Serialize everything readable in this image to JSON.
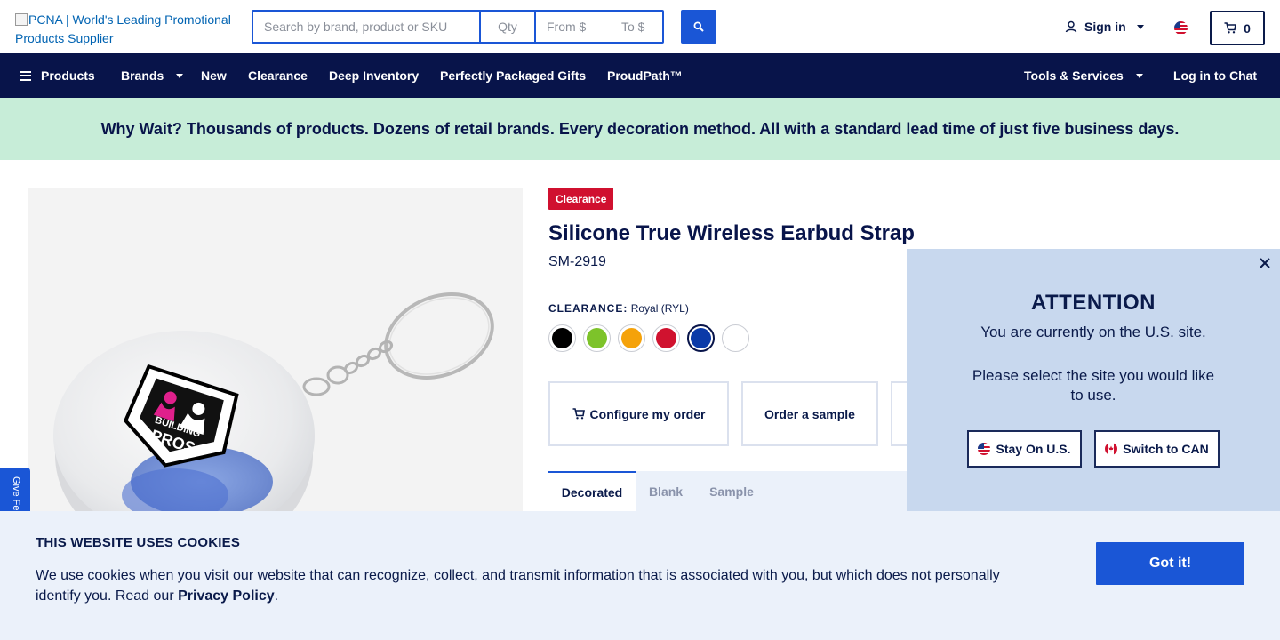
{
  "header": {
    "logo_alt": "PCNA | World's Leading Promotional Products Supplier",
    "search_placeholder": "Search by brand, product or SKU",
    "qty_placeholder": "Qty",
    "from_placeholder": "From $",
    "range_separator": "—",
    "to_placeholder": "To $",
    "signin_label": "Sign in",
    "cart_count": "0",
    "accent_color": "#1a56d6"
  },
  "nav": {
    "items": [
      {
        "label": "Products"
      },
      {
        "label": "Brands"
      },
      {
        "label": "New"
      },
      {
        "label": "Clearance"
      },
      {
        "label": "Deep Inventory"
      },
      {
        "label": "Perfectly Packaged Gifts"
      },
      {
        "label": "ProudPath™"
      }
    ],
    "tools_label": "Tools & Services",
    "chat_label": "Log in to Chat",
    "background_color": "#08144a"
  },
  "promo": {
    "text": "Why Wait? Thousands of products. Dozens of retail brands. Every decoration method. All with a standard lead time of just five business days."
  },
  "product": {
    "badge": "Clearance",
    "title": "Silicone True Wireless Earbud Strap",
    "sku": "SM-2919",
    "color_heading": "CLEARANCE:",
    "selected_color": "Royal (RYL)",
    "swatches": [
      {
        "name": "Black",
        "color": "#000000"
      },
      {
        "name": "Lime Green",
        "color": "#7dc32a"
      },
      {
        "name": "Orange",
        "color": "#f5a20a"
      },
      {
        "name": "Red",
        "color": "#d0122f"
      },
      {
        "name": "Royal",
        "color": "#0a3aa8",
        "selected": true
      },
      {
        "name": "White",
        "color": "#ffffff"
      }
    ],
    "actions": {
      "configure": "Configure my order",
      "sample": "Order a sample"
    },
    "tabs": [
      {
        "label": "Decorated",
        "active": true
      },
      {
        "label": "Blank"
      },
      {
        "label": "Sample"
      }
    ],
    "image_logo": {
      "line1": "BUILDING",
      "line2": "PROS"
    }
  },
  "feedback": {
    "label": "Give Feedback"
  },
  "attention": {
    "title": "ATTENTION",
    "message": "You are currently on the U.S. site.",
    "prompt": "Please select the site you would like to use.",
    "stay_label": "Stay On U.S.",
    "switch_label": "Switch to CAN"
  },
  "cookies": {
    "title": "THIS WEBSITE USES COOKIES",
    "text": "We use cookies when you visit our website that can recognize, collect, and transmit information that is associated with you, but which does not personally identify you. Read our",
    "link": "Privacy Policy",
    "end": ".",
    "button": "Got it!"
  }
}
